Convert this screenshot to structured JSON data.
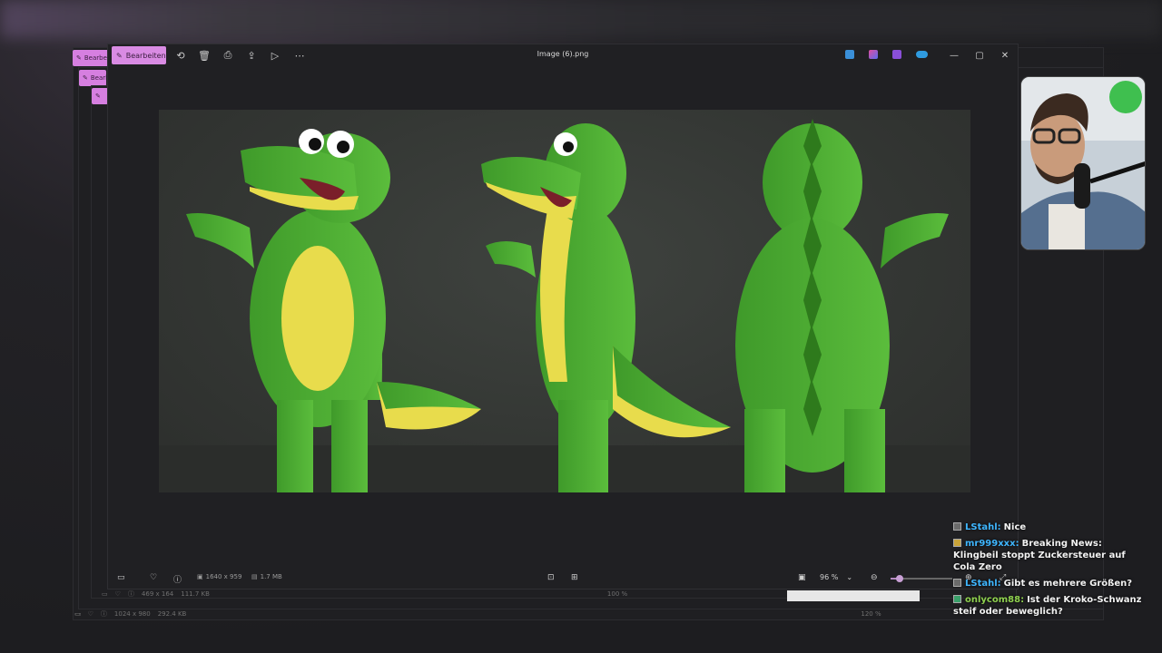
{
  "main_window": {
    "edit_label": "Bearbeiten",
    "title": "Image (6).png",
    "status": {
      "dimensions": "1640 x 959",
      "size": "1.7 MB",
      "zoom": "96 %"
    }
  },
  "back_windows": [
    {
      "edit_label": "Bearbei",
      "dimensions": "469 x 164",
      "size": "111.7 KB",
      "zoom": "100 %"
    },
    {
      "edit_label": "Bearb",
      "dimensions": "1024 x 980",
      "size": "292.4 KB",
      "zoom": "120 %"
    }
  ],
  "icons": {
    "rotate": "rotate-icon",
    "delete": "trash-icon",
    "print": "print-icon",
    "share": "share-icon",
    "slideshow": "slideshow-icon",
    "more": "more-icon"
  },
  "colors": {
    "accent_pink": "#d98be3",
    "gator_green": "#4aa832",
    "belly_yellow": "#e8dc4c",
    "chat_user_cyan": "#3fb6ff"
  },
  "chat": [
    {
      "user": "LStahl:",
      "text": "Nice",
      "color": "#3fb6ff"
    },
    {
      "user": "mr999xxx:",
      "text": "Breaking News: Klingbeil stoppt Zuckersteuer auf Cola Zero",
      "color": "#3fb6ff"
    },
    {
      "user": "LStahl:",
      "text": "Gibt es mehrere Größen?",
      "color": "#3fb6ff"
    },
    {
      "user": "onlycom88:",
      "text": "Ist der Kroko-Schwanz steif oder beweglich?",
      "color": "#8fd14f"
    }
  ]
}
